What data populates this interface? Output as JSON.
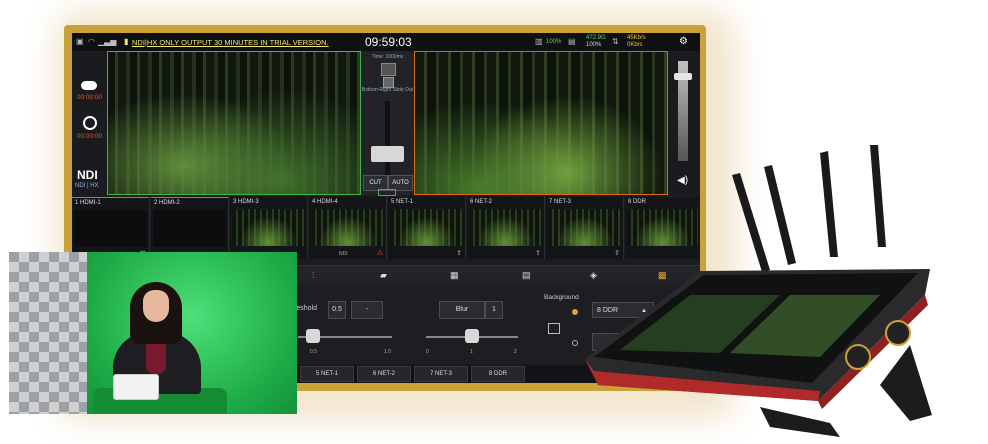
{
  "topbar": {
    "warning": "NDI|HX ONLY OUTPUT 30 MINUTES IN TRIAL VERSION.",
    "clock": "09:59:03",
    "stat_a": "100%",
    "stat_b1": "472.9G",
    "stat_b2": "100%",
    "stat_c1": "45Kb/s",
    "stat_c2": "0Kb/s",
    "settings_icon": "gear-icon"
  },
  "left_panel": {
    "stream_time": "00:00:00",
    "record_time": "00:00:00",
    "ndi_logo": "NDI",
    "ndi_sub": "NDI | HX"
  },
  "transition": {
    "label_time": "Time: 1000ms",
    "label_effect": "Bottom-Right Slide Out",
    "cut": "CUT",
    "auto": "AUTO"
  },
  "sources": [
    {
      "num": "1",
      "name": "HDMI-1"
    },
    {
      "num": "2",
      "name": "HDMI-2"
    },
    {
      "num": "3",
      "name": "HDMI-3"
    },
    {
      "num": "4",
      "name": "HDMI-4"
    },
    {
      "num": "5",
      "name": "NET-1"
    },
    {
      "num": "6",
      "name": "NET-2"
    },
    {
      "num": "7",
      "name": "NET-3"
    },
    {
      "num": "8",
      "name": "DDR"
    }
  ],
  "thumb_ndi_tag": "NDI",
  "controls": {
    "threshold_label": "reshold",
    "threshold_value": "0.5",
    "minus_label": "-",
    "threshold_scale": [
      "0.5",
      "1.0"
    ],
    "blur_label": "Blur",
    "blur_value": "1",
    "blur_scale": [
      "0",
      "1",
      "2"
    ],
    "background_label": "Background",
    "background_select": "8 DDR"
  },
  "source_buttons": [
    "5 NET-1",
    "6 NET-2",
    "7 NET-3",
    "8 DDR"
  ],
  "device": {
    "screen_header": "",
    "side_label": ""
  }
}
